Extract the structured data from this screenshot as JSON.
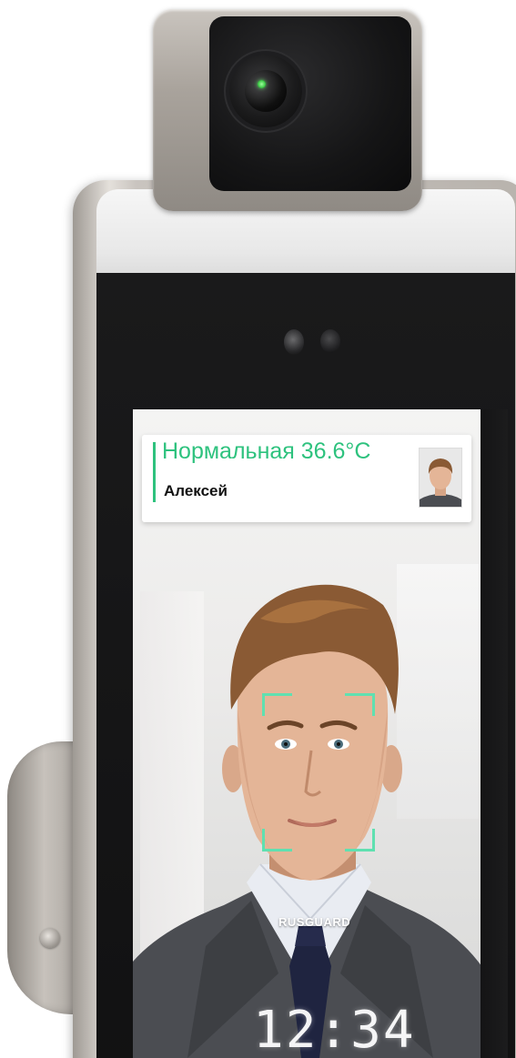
{
  "device": {
    "brand": "RUSGUARD",
    "clock": "12:34"
  },
  "notification": {
    "status": "Нормальная 36.6°C",
    "name": "Алексей"
  },
  "colors": {
    "accent": "#2ec27e",
    "face_frame": "#5fe0b0"
  }
}
